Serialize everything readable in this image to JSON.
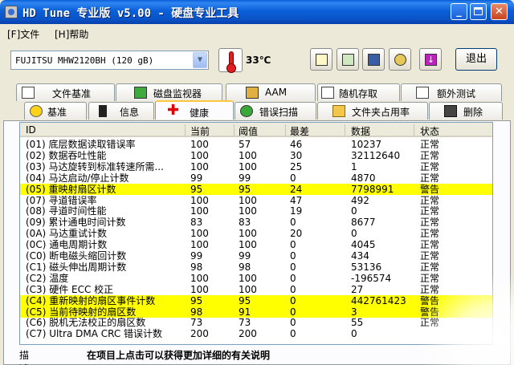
{
  "window": {
    "title": "HD Tune 专业版 v5.00 - 硬盘专业工具"
  },
  "menu": [
    {
      "label": "[F]文件"
    },
    {
      "label": "[H]帮助"
    }
  ],
  "toolbar": {
    "drive": "FUJITSU MHW2120BH        (120 gB)",
    "temperature": "33℃",
    "exit_label": "退出"
  },
  "tabs_top": [
    {
      "label": "文件基准",
      "icon": "file-benchmark-icon"
    },
    {
      "label": "磁盘监视器",
      "icon": "disk-monitor-icon"
    },
    {
      "label": "AAM",
      "icon": "speaker-icon"
    },
    {
      "label": "随机存取",
      "icon": "random-access-icon"
    },
    {
      "label": "额外测试",
      "icon": "extra-tests-icon"
    }
  ],
  "tabs_bottom": [
    {
      "label": "基准",
      "icon": "benchmark-icon"
    },
    {
      "label": "信息",
      "icon": "info-icon"
    },
    {
      "label": "健康",
      "icon": "health-icon",
      "active": true
    },
    {
      "label": "错误扫描",
      "icon": "error-scan-icon"
    },
    {
      "label": "文件夹占用率",
      "icon": "folder-usage-icon"
    },
    {
      "label": "删除",
      "icon": "erase-icon"
    }
  ],
  "grid": {
    "headers": {
      "id": "ID",
      "current": "当前",
      "threshold": "阈值",
      "worst": "最差",
      "data": "数据",
      "status": "状态"
    },
    "rows": [
      {
        "id": "(01) 底层数据读取错误率",
        "current": "100",
        "threshold": "57",
        "worst": "46",
        "data": "10237",
        "status": "正常",
        "warn": false
      },
      {
        "id": "(02) 数据吞吐性能",
        "current": "100",
        "threshold": "100",
        "worst": "30",
        "data": "32112640",
        "status": "正常",
        "warn": false
      },
      {
        "id": "(03) 马达旋转到标准转速所需...",
        "current": "100",
        "threshold": "100",
        "worst": "25",
        "data": "1",
        "status": "正常",
        "warn": false
      },
      {
        "id": "(04) 马达启动/停止计数",
        "current": "99",
        "threshold": "99",
        "worst": "0",
        "data": "4870",
        "status": "正常",
        "warn": false
      },
      {
        "id": "(05) 重映射扇区计数",
        "current": "95",
        "threshold": "95",
        "worst": "24",
        "data": "7798991",
        "status": "警告",
        "warn": true
      },
      {
        "id": "(07) 寻道错误率",
        "current": "100",
        "threshold": "100",
        "worst": "47",
        "data": "492",
        "status": "正常",
        "warn": false
      },
      {
        "id": "(08) 寻道时间性能",
        "current": "100",
        "threshold": "100",
        "worst": "19",
        "data": "0",
        "status": "正常",
        "warn": false
      },
      {
        "id": "(09) 累计通电时间计数",
        "current": "83",
        "threshold": "83",
        "worst": "0",
        "data": "8677",
        "status": "正常",
        "warn": false
      },
      {
        "id": "(0A) 马达重试计数",
        "current": "100",
        "threshold": "100",
        "worst": "20",
        "data": "0",
        "status": "正常",
        "warn": false
      },
      {
        "id": "(0C) 通电周期计数",
        "current": "100",
        "threshold": "100",
        "worst": "0",
        "data": "4045",
        "status": "正常",
        "warn": false
      },
      {
        "id": "(C0) 断电磁头缩回计数",
        "current": "99",
        "threshold": "99",
        "worst": "0",
        "data": "434",
        "status": "正常",
        "warn": false
      },
      {
        "id": "(C1) 磁头伸出周期计数",
        "current": "98",
        "threshold": "98",
        "worst": "0",
        "data": "53136",
        "status": "正常",
        "warn": false
      },
      {
        "id": "(C2) 温度",
        "current": "100",
        "threshold": "100",
        "worst": "0",
        "data": "-196574",
        "status": "正常",
        "warn": false
      },
      {
        "id": "(C3) 硬件 ECC 校正",
        "current": "100",
        "threshold": "100",
        "worst": "0",
        "data": "27",
        "status": "正常",
        "warn": false
      },
      {
        "id": "(C4) 重新映射的扇区事件计数",
        "current": "95",
        "threshold": "95",
        "worst": "0",
        "data": "442761423",
        "status": "警告",
        "warn": true
      },
      {
        "id": "(C5) 当前待映射的扇区数",
        "current": "98",
        "threshold": "91",
        "worst": "0",
        "data": "3",
        "status": "警告",
        "warn": true
      },
      {
        "id": "(C6) 脱机无法校正的扇区数",
        "current": "73",
        "threshold": "73",
        "worst": "0",
        "data": "55",
        "status": "正常",
        "warn": false
      },
      {
        "id": "(C7) Ultra DMA CRC 错误计数",
        "current": "200",
        "threshold": "200",
        "worst": "0",
        "data": "0",
        "status": "",
        "warn": false
      }
    ]
  },
  "description": {
    "label": "描述:",
    "text": "在项目上点击可以获得更加详细的有关说明"
  }
}
